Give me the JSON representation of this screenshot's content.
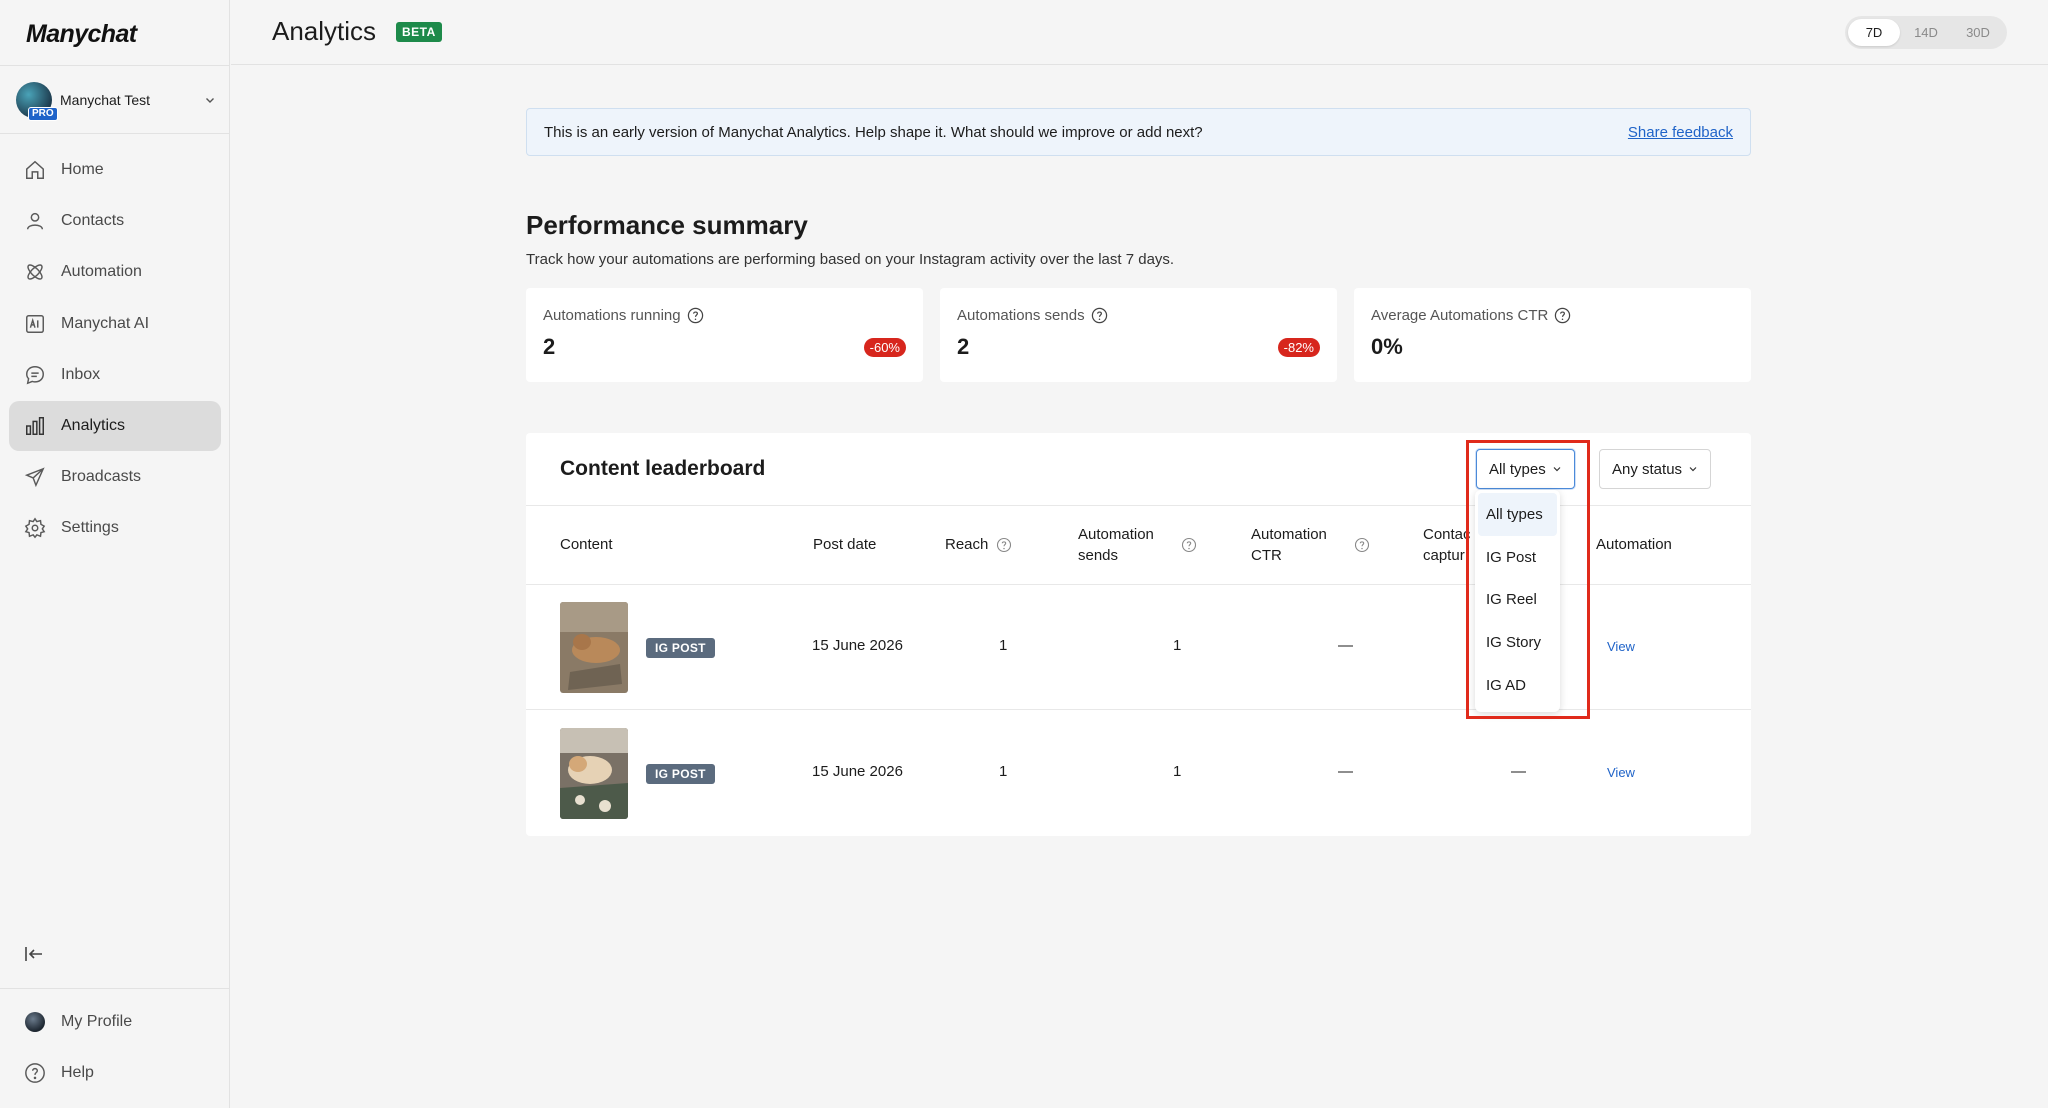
{
  "app": {
    "logo": "Manychat",
    "account_name": "Manychat Test",
    "account_badge": "PRO"
  },
  "sidebar": {
    "items": [
      {
        "label": "Home",
        "icon": "home-icon"
      },
      {
        "label": "Contacts",
        "icon": "person-icon"
      },
      {
        "label": "Automation",
        "icon": "automation-icon"
      },
      {
        "label": "Manychat AI",
        "icon": "ai-icon"
      },
      {
        "label": "Inbox",
        "icon": "chat-icon"
      },
      {
        "label": "Analytics",
        "icon": "bar-chart-icon",
        "active": true
      },
      {
        "label": "Broadcasts",
        "icon": "send-icon"
      },
      {
        "label": "Settings",
        "icon": "gear-icon"
      }
    ],
    "bottom": [
      {
        "label": "My Profile",
        "icon": "profile-avatar"
      },
      {
        "label": "Help",
        "icon": "help-icon"
      }
    ]
  },
  "header": {
    "title": "Analytics",
    "badge": "BETA",
    "ranges": [
      "7D",
      "14D",
      "30D"
    ],
    "active_range": "7D"
  },
  "banner": {
    "text": "This is an early version of Manychat Analytics. Help shape it. What should we improve or add next?",
    "link": "Share feedback"
  },
  "summary": {
    "title": "Performance summary",
    "subtitle": "Track how your automations are performing based on your Instagram activity over the last 7 days.",
    "cards": [
      {
        "label": "Automations running",
        "value": "2",
        "delta": "-60%"
      },
      {
        "label": "Automations sends",
        "value": "2",
        "delta": "-82%"
      },
      {
        "label": "Average Automations CTR",
        "value": "0%",
        "delta": ""
      }
    ]
  },
  "leaderboard": {
    "title": "Content leaderboard",
    "filter_type": "All types",
    "filter_status": "Any status",
    "columns": {
      "content": "Content",
      "post_date": "Post date",
      "reach": "Reach",
      "sends_1": "Automation",
      "sends_2": "sends",
      "ctr_1": "Automation",
      "ctr_2": "CTR",
      "contacts_1": "Contac",
      "contacts_2": "captur",
      "automation": "Automation"
    },
    "rows": [
      {
        "tag": "IG POST",
        "date": "15 June 2026",
        "reach": "1",
        "sends": "1",
        "ctr": "—",
        "contacts": "",
        "action": "View"
      },
      {
        "tag": "IG POST",
        "date": "15 June 2026",
        "reach": "1",
        "sends": "1",
        "ctr": "—",
        "contacts": "—",
        "action": "View"
      }
    ]
  },
  "type_dropdown": {
    "options": [
      "All types",
      "IG Post",
      "IG Reel",
      "IG Story",
      "IG AD"
    ],
    "selected": "All types"
  },
  "colors": {
    "accent": "#1f63c8",
    "beta_green": "#1d8a4a",
    "delta_red": "#d7261d",
    "highlight_red": "#e02a1b"
  }
}
